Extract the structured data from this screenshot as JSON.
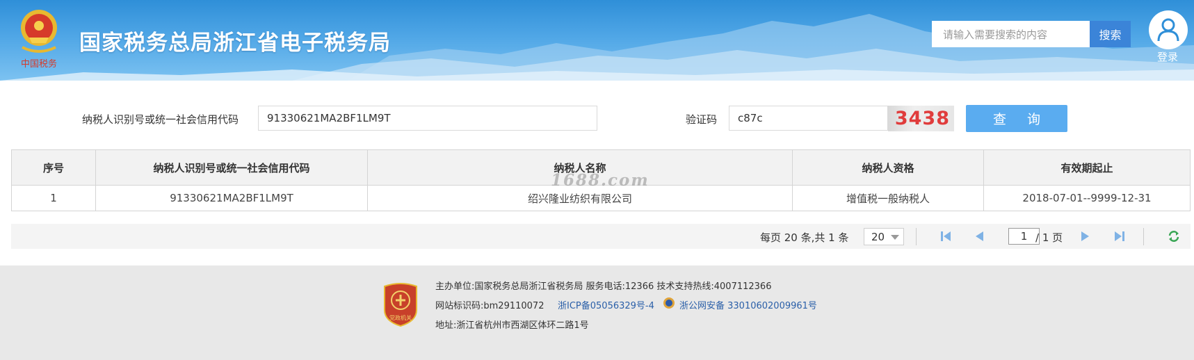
{
  "header": {
    "site_title": "国家税务总局浙江省电子税务局",
    "emblem_caption": "中国税务",
    "search_placeholder": "请输入需要搜索的内容",
    "search_label": "搜索",
    "login_label": "登录"
  },
  "query_form": {
    "taxpayer_id_label": "纳税人识别号或统一社会信用代码",
    "taxpayer_id_value": "91330621MA2BF1LM9T",
    "captcha_label": "验证码",
    "captcha_input_value": "c87c",
    "captcha_image_text": "3438",
    "query_button_label": "查 询"
  },
  "table": {
    "columns": [
      "序号",
      "纳税人识别号或统一社会信用代码",
      "纳税人名称",
      "纳税人资格",
      "有效期起止"
    ],
    "rows": [
      [
        "1",
        "91330621MA2BF1LM9T",
        "绍兴隆业纺织有限公司",
        "增值税一般纳税人",
        "2018-07-01--9999-12-31"
      ]
    ]
  },
  "watermark": "1688.com",
  "pagination": {
    "summary": "每页 20 条,共 1 条",
    "page_size": "20",
    "current_page": "1",
    "total_pages": "/ 1 页"
  },
  "footer": {
    "line1": "主办单位:国家税务总局浙江省税务局    服务电话:12366    技术支持热线:4007112366",
    "site_id": "网站标识码:bm29110072",
    "icp": "浙ICP备05056329号-4",
    "police": "浙公网安备 33010602009961号",
    "address": "地址:浙江省杭州市西湖区体环二路1号",
    "badge_caption": "党政机关"
  },
  "colors": {
    "header_blue": "#2f8fd8",
    "button_blue": "#5aacf0",
    "search_button": "#3b84d8",
    "captcha_red": "#e03c3c",
    "link_blue": "#2a5fa8"
  },
  "icons": [
    "tax-emblem-icon",
    "user-icon",
    "first-page-icon",
    "prev-page-icon",
    "next-page-icon",
    "last-page-icon",
    "refresh-icon",
    "party-badge-icon",
    "police-badge-icon"
  ]
}
